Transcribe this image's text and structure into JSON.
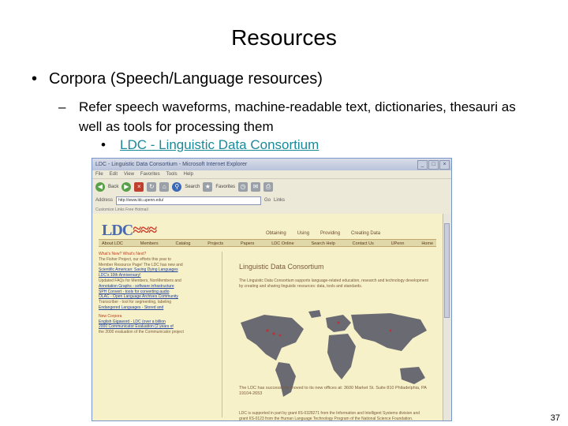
{
  "slide": {
    "title": "Resources",
    "bullet1": "Corpora (Speech/Language  resources)",
    "bullet2": "Refer speech waveforms, machine-readable text, dictionaries, thesauri as well as tools for processing them",
    "bullet3_link": "LDC - Linguistic Data Consortium",
    "page_number": "37"
  },
  "browser": {
    "window_title": "LDC - Linguistic Data Consortium - Microsoft Internet Explorer",
    "menu": [
      "File",
      "Edit",
      "View",
      "Favorites",
      "Tools",
      "Help"
    ],
    "toolbar": {
      "back": "Back",
      "search": "Search",
      "favorites": "Favorites"
    },
    "address_label": "Address",
    "address_value": "http://www.ldc.upenn.edu/",
    "go_label": "Go",
    "links_label": "Links",
    "customize_label": "Customize Links",
    "free_hotmail_label": "Free Hotmail",
    "links_bar_text": "Customize Links   Free Hotmail"
  },
  "ldc_site": {
    "logo_left": "LDC",
    "logo_right": "≈≈≈",
    "top_links": [
      "Obtaining",
      "Using",
      "Providing",
      "Creating Data"
    ],
    "nav": [
      "About LDC",
      "Members",
      "Catalog",
      "Projects",
      "Papers",
      "LDC Online",
      "Search Help",
      "Contact Us",
      "UPenn",
      "Home"
    ],
    "left_column": [
      {
        "text": "What's New? What's Next?",
        "style": "hd"
      },
      {
        "text": "The Fisher Project, our efforts this year to",
        "style": ""
      },
      {
        "text": "Member Resource Page! The LDC has new and",
        "style": ""
      },
      {
        "text": "Scientific American: Saving Dying Languages",
        "style": "lk"
      },
      {
        "text": "LDC's 10th Anniversary!",
        "style": "lk"
      },
      {
        "text": "Updated FAQs for Members, NonMembers and",
        "style": ""
      },
      {
        "text": "Annotation Graphs - software infrastructure",
        "style": "lk"
      },
      {
        "text": "SPH Convert - tools for converting audio",
        "style": "lk"
      },
      {
        "text": "OLAC - Open Language Archives Community",
        "style": "lk"
      },
      {
        "text": "Transcriber - tool for segmenting, labeling",
        "style": ""
      },
      {
        "text": "Endangered Languages - Stored and",
        "style": "lk"
      },
      {
        "text": "New Corpora",
        "style": "hd"
      },
      {
        "text": "English Gigaword - LDC (over a billion",
        "style": "lk"
      },
      {
        "text": "2000 Communicator Evaluation (2 years of",
        "style": "lk"
      },
      {
        "text": "the 2000 evaluation of the Communicator project",
        "style": ""
      }
    ],
    "heading": "Linguistic Data Consortium",
    "description": "The Linguistic Data Consortium supports language-related education, research and technology development by creating and sharing linguistic resources: data, tools and standards.",
    "moved": "The LDC has successfully moved to its new offices at: 3600 Market St. Suite 810 Philadelphia, PA 19104-2653",
    "support": "LDC is supported in part by grant IIS-0328271 from the Information and Intelligent Systems division and grant IIS-0123 from the Human Language Technology Program of the National Science Foundation."
  }
}
